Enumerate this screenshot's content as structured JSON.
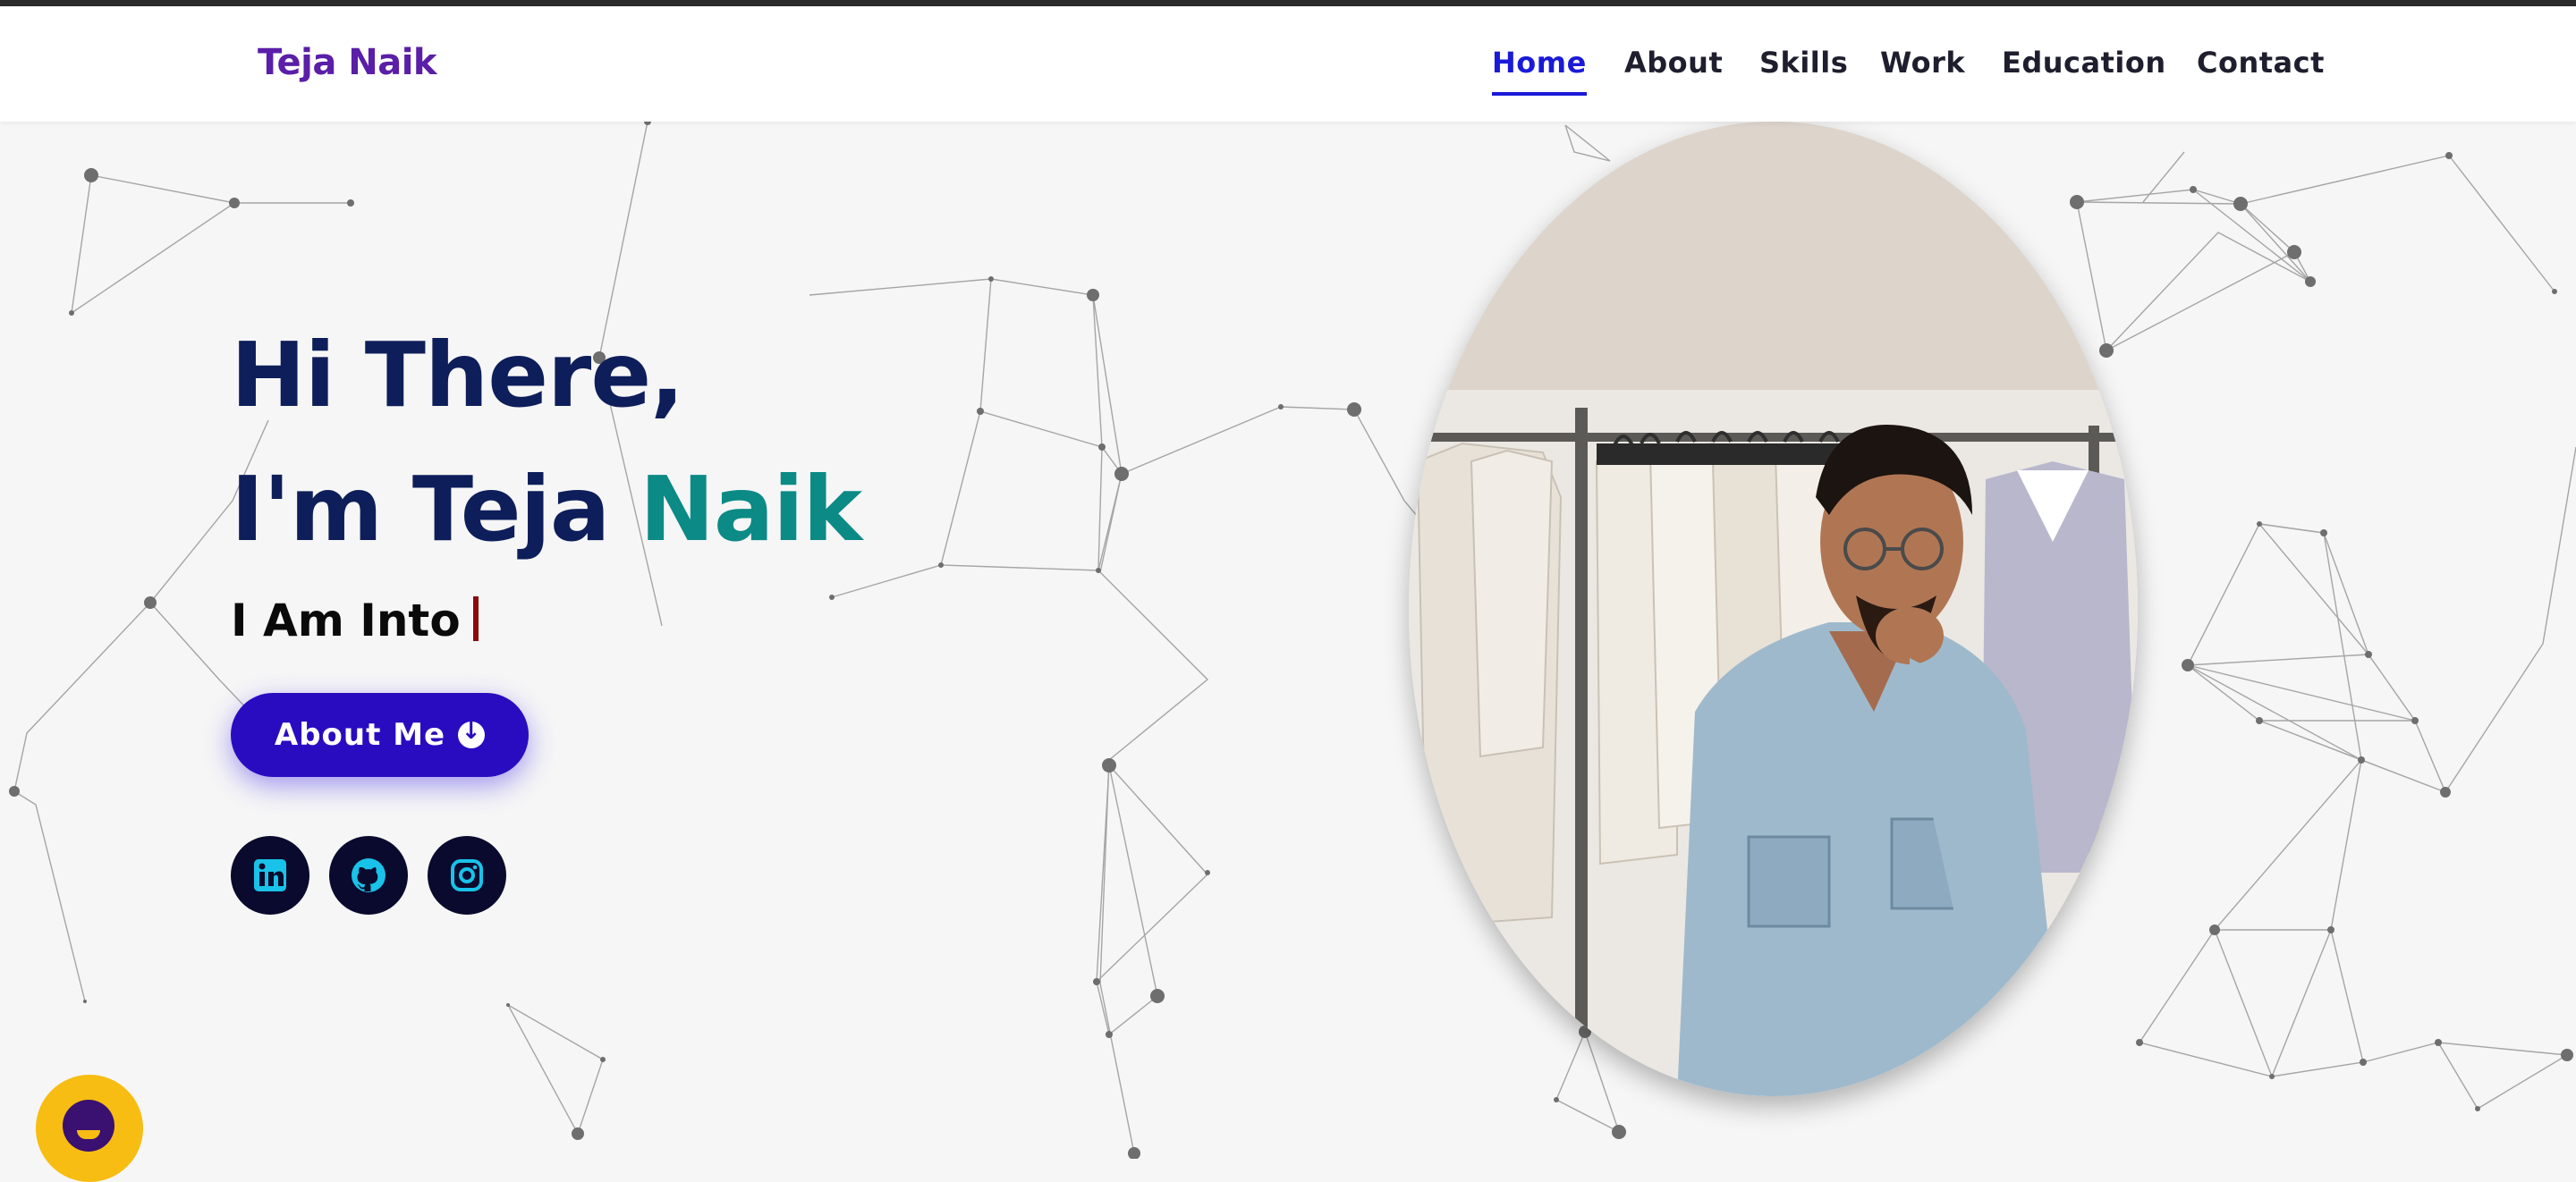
{
  "brand": {
    "name": "Teja Naik"
  },
  "nav": {
    "items": [
      {
        "label": "Home",
        "active": true
      },
      {
        "label": "About",
        "active": false
      },
      {
        "label": "Skills",
        "active": false
      },
      {
        "label": "Work",
        "active": false
      },
      {
        "label": "Education",
        "active": false
      },
      {
        "label": "Contact",
        "active": false
      }
    ]
  },
  "hero": {
    "greeting": "Hi There,",
    "intro_prefix": "I'm Teja ",
    "intro_highlight": "Naik",
    "typed_prefix": "I Am Into",
    "cta_label": "About Me",
    "cta_icon": "arrow-circle-down-icon"
  },
  "social": [
    {
      "name": "linkedin-icon"
    },
    {
      "name": "github-icon"
    },
    {
      "name": "instagram-icon"
    }
  ],
  "photo": {
    "description_icon": "profile-photo"
  },
  "chat": {
    "icon": "chat-bot-icon"
  },
  "colors": {
    "brand": "#5a1ea8",
    "nav_active": "#1a1ad8",
    "heading": "#0e1e5a",
    "accent": "#0b8a86",
    "cta": "#2a0cc0",
    "social_bg": "#0a0a2e",
    "social_icon": "#19c2e8",
    "chat_bg": "#f7bd12"
  }
}
